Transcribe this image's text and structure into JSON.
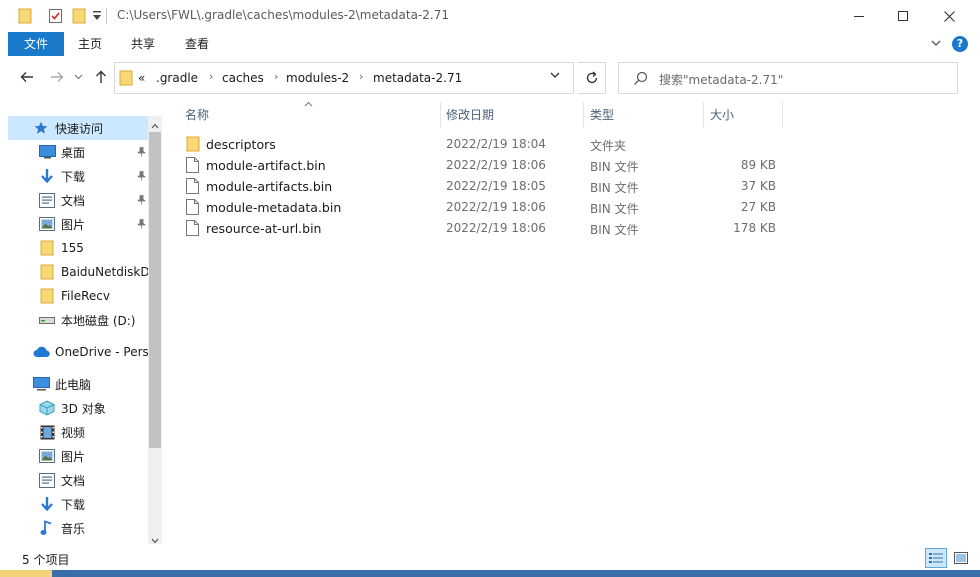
{
  "window": {
    "title": "C:\\Users\\FWL\\.gradle\\caches\\modules-2\\metadata-2.71"
  },
  "ribbon": {
    "tabs": [
      {
        "label": "文件"
      },
      {
        "label": "主页"
      },
      {
        "label": "共享"
      },
      {
        "label": "查看"
      }
    ],
    "help": "?"
  },
  "address": {
    "overflow": "«",
    "crumbs": [
      ".gradle",
      "caches",
      "modules-2",
      "metadata-2.71"
    ],
    "separator": "›"
  },
  "search": {
    "placeholder": "搜索\"metadata-2.71\""
  },
  "nav": {
    "items": [
      {
        "label": "快速访问",
        "icon": "star-icon"
      },
      {
        "label": "桌面",
        "icon": "desktop-icon"
      },
      {
        "label": "下载",
        "icon": "download-icon"
      },
      {
        "label": "文档",
        "icon": "document-icon"
      },
      {
        "label": "图片",
        "icon": "picture-icon"
      },
      {
        "label": "155",
        "icon": "folder-icon"
      },
      {
        "label": "BaiduNetdiskD",
        "icon": "folder-icon"
      },
      {
        "label": "FileRecv",
        "icon": "folder-icon"
      },
      {
        "label": "本地磁盘 (D:)",
        "icon": "drive-icon"
      },
      {
        "label": "OneDrive - Perso",
        "icon": "cloud-icon"
      },
      {
        "label": "此电脑",
        "icon": "computer-icon"
      },
      {
        "label": "3D 对象",
        "icon": "cube-icon"
      },
      {
        "label": "视频",
        "icon": "video-icon"
      },
      {
        "label": "图片",
        "icon": "picture-icon"
      },
      {
        "label": "文档",
        "icon": "document-icon"
      },
      {
        "label": "下载",
        "icon": "download-icon"
      },
      {
        "label": "音乐",
        "icon": "music-icon"
      }
    ]
  },
  "columns": {
    "name": "名称",
    "date": "修改日期",
    "type": "类型",
    "size": "大小"
  },
  "files": [
    {
      "name": "descriptors",
      "date": "2022/2/19 18:04",
      "type": "文件夹",
      "size": "",
      "icon": "folder-icon"
    },
    {
      "name": "module-artifact.bin",
      "date": "2022/2/19 18:06",
      "type": "BIN 文件",
      "size": "89 KB",
      "icon": "file-icon"
    },
    {
      "name": "module-artifacts.bin",
      "date": "2022/2/19 18:05",
      "type": "BIN 文件",
      "size": "37 KB",
      "icon": "file-icon"
    },
    {
      "name": "module-metadata.bin",
      "date": "2022/2/19 18:06",
      "type": "BIN 文件",
      "size": "27 KB",
      "icon": "file-icon"
    },
    {
      "name": "resource-at-url.bin",
      "date": "2022/2/19 18:06",
      "type": "BIN 文件",
      "size": "178 KB",
      "icon": "file-icon"
    }
  ],
  "status": {
    "count": "5 个项目"
  },
  "colors": {
    "accent": "#1979ca",
    "selection": "#cce8ff",
    "folder": "#f8d775",
    "header_text": "#4c607a"
  }
}
